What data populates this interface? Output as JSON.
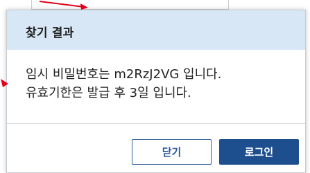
{
  "dialog": {
    "title": "찾기 결과",
    "message_line1": "임시 비밀번호는 m2RzJ2VG 입니다.",
    "message_line2": "유효기한은 발급 후 3일 입니다.",
    "close_label": "닫기",
    "login_label": "로그인"
  },
  "colors": {
    "header_bg": "#d8e7f5",
    "primary": "#1d4f8f",
    "annotation": "#e0001b"
  }
}
